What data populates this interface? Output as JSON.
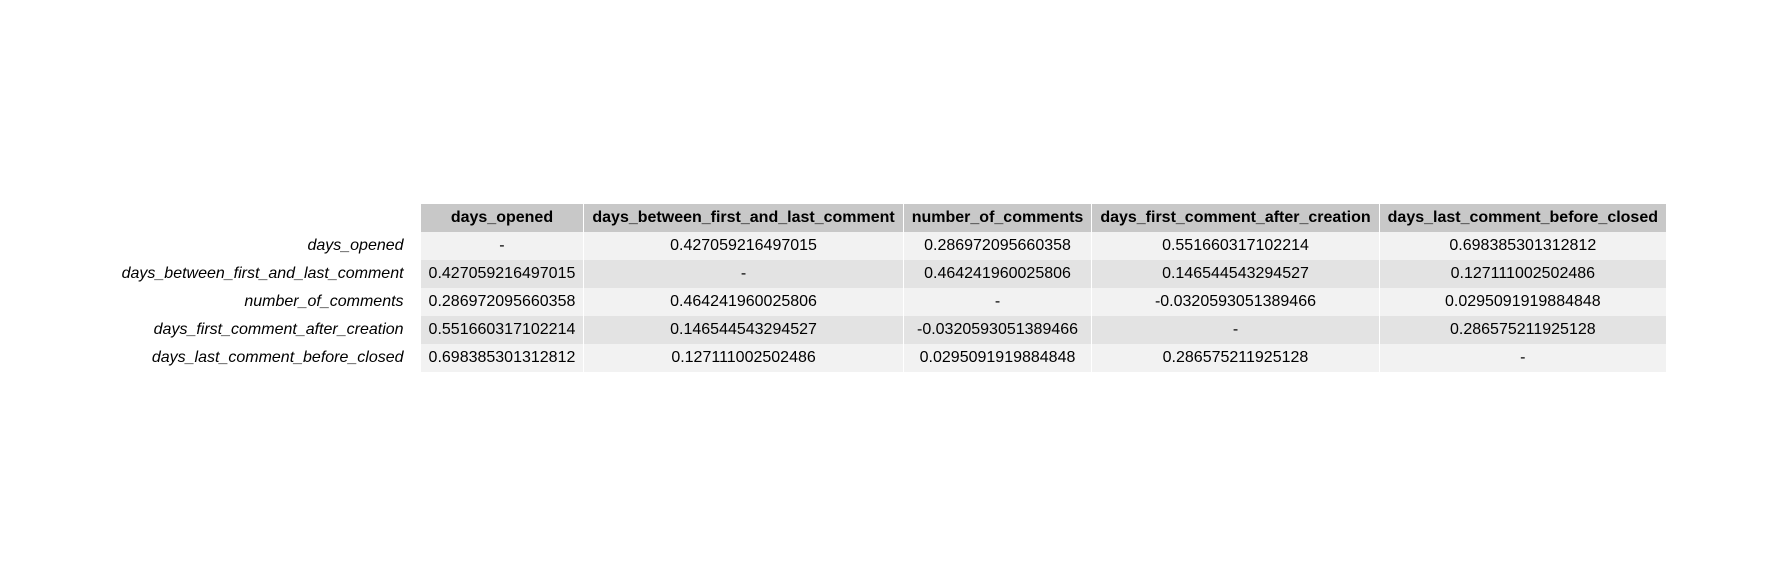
{
  "chart_data": {
    "type": "table",
    "columns": [
      "days_opened",
      "days_between_first_and_last_comment",
      "number_of_comments",
      "days_first_comment_after_creation",
      "days_last_comment_before_closed"
    ],
    "rows": [
      {
        "label": "days_opened",
        "cells": [
          "-",
          "0.427059216497015",
          "0.286972095660358",
          "0.551660317102214",
          "0.698385301312812"
        ]
      },
      {
        "label": "days_between_first_and_last_comment",
        "cells": [
          "0.427059216497015",
          "-",
          "0.464241960025806",
          "0.146544543294527",
          "0.127111002502486"
        ]
      },
      {
        "label": "number_of_comments",
        "cells": [
          "0.286972095660358",
          "0.464241960025806",
          "-",
          "-0.0320593051389466",
          "0.0295091919884848"
        ]
      },
      {
        "label": "days_first_comment_after_creation",
        "cells": [
          "0.551660317102214",
          "0.146544543294527",
          "-0.0320593051389466",
          "-",
          "0.286575211925128"
        ]
      },
      {
        "label": "days_last_comment_before_closed",
        "cells": [
          "0.698385301312812",
          "0.127111002502486",
          "0.0295091919884848",
          "0.286575211925128",
          "-"
        ]
      }
    ]
  }
}
